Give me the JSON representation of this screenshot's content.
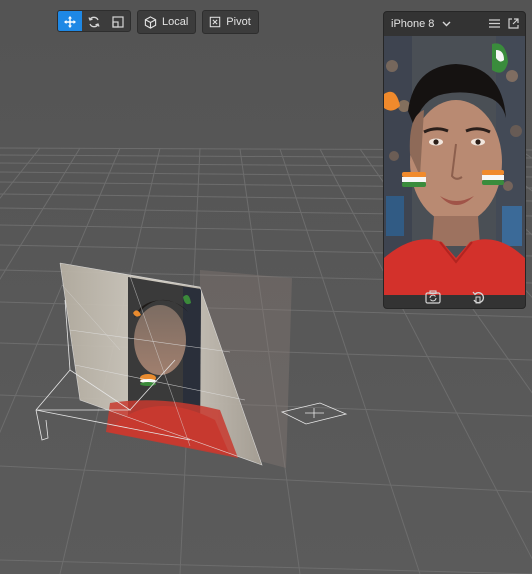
{
  "toolbar": {
    "move_icon": "move-arrows-icon",
    "rotate_icon": "rotate-icon",
    "scale_icon": "scale-icon",
    "local_icon": "cube-icon",
    "local_label": "Local",
    "pivot_icon": "pivot-icon",
    "pivot_label": "Pivot",
    "active_color": "#1e88e5"
  },
  "preview": {
    "device_name": "iPhone 8",
    "menu_icon": "hamburger-menu-icon",
    "popout_icon": "popout-icon",
    "footer": {
      "camera_icon": "camera-switch-icon",
      "reset_icon": "reset-icon"
    }
  },
  "scene": {
    "background": "#5a5a5a",
    "grid_color": "#6e6e6e"
  }
}
